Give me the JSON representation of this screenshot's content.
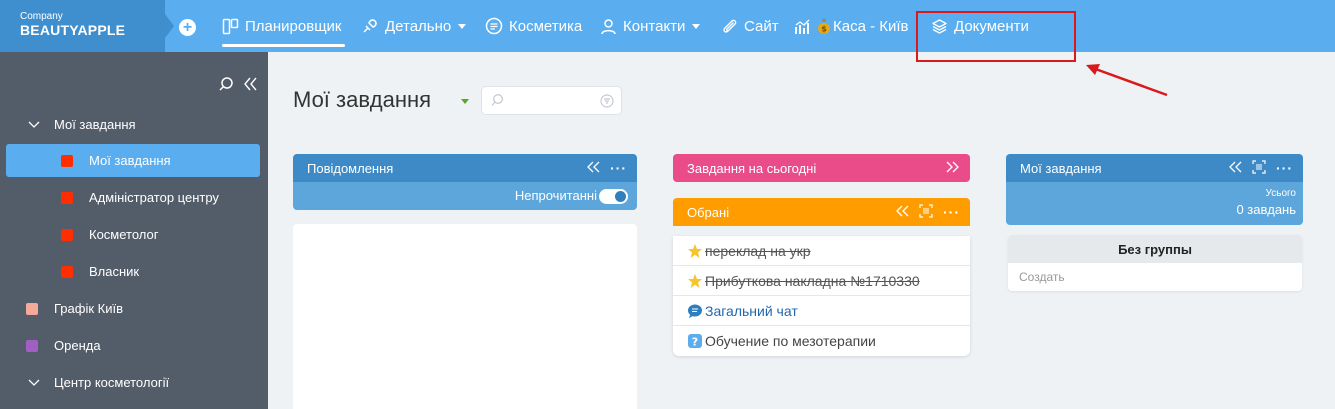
{
  "brand": {
    "company": "Company",
    "name": "BEAUTYAPPLE"
  },
  "nav": {
    "items": [
      {
        "label": "Планировщик",
        "icon": "planner-icon"
      },
      {
        "label": "Детально",
        "icon": "puzzle-icon"
      },
      {
        "label": "Косметика",
        "icon": "circle-lines-icon"
      },
      {
        "label": "Контакти",
        "icon": "person-icon"
      },
      {
        "label": "Сайт",
        "icon": "paperclip-icon"
      },
      {
        "label": "Каса - Київ",
        "icon": "chart-moneybag-icon"
      },
      {
        "label": "Документи",
        "icon": "layers-icon"
      }
    ]
  },
  "sidebar": {
    "items": [
      {
        "label": "Мої завдання",
        "type": "group"
      },
      {
        "label": "Мої завдання",
        "color": "#ff2d00"
      },
      {
        "label": "Адміністратор центру",
        "color": "#ff2d00"
      },
      {
        "label": "Косметолог",
        "color": "#ff2d00"
      },
      {
        "label": "Власник",
        "color": "#ff2d00"
      },
      {
        "label": "Графік Київ",
        "color": "#f4a99a"
      },
      {
        "label": "Оренда",
        "color": "#a35ec5"
      },
      {
        "label": "Центр косметології",
        "type": "group"
      }
    ]
  },
  "page": {
    "title": "Мої завдання",
    "search_placeholder": ""
  },
  "messages": {
    "title": "Повідомлення",
    "filter": "Непрочитанні",
    "unread_only": true
  },
  "today": {
    "title": "Завдання на сьогодні"
  },
  "favorites": {
    "title": "Обрані",
    "items": [
      {
        "label": "переклад на укр",
        "icon": "star-icon",
        "done": true
      },
      {
        "label": "Прибуткова накладна №1710330",
        "icon": "star-icon",
        "done": true
      },
      {
        "label": "Загальний чат",
        "icon": "chat-icon",
        "done": false
      },
      {
        "label": "Обучение по мезотерапии",
        "icon": "question-icon",
        "done": false
      }
    ]
  },
  "my_tasks": {
    "title": "Мої завдання",
    "total_label": "Усього",
    "total_value": "0 завдань",
    "group_name": "Без группы",
    "create_label": "Создать"
  },
  "colors": {
    "topbar": "#5aaef0",
    "sidebar": "#535c69",
    "messages_header": "#3d8ac7",
    "today_header": "#ea4c89",
    "favorites_header": "#ff9d00",
    "highlight": "#d9191c"
  }
}
